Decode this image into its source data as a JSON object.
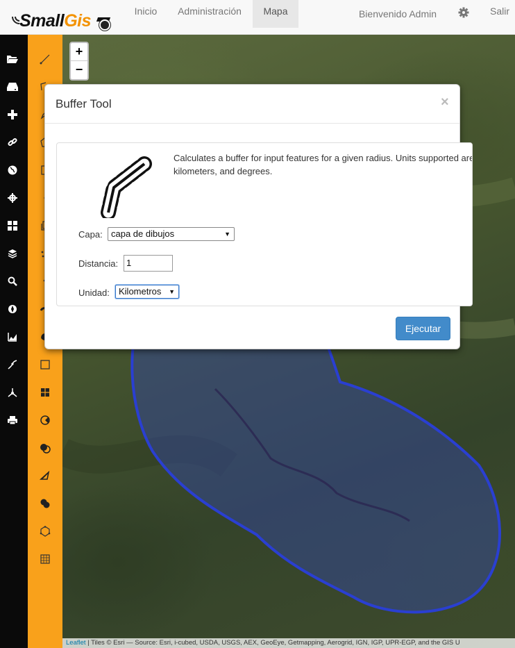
{
  "brand": {
    "name_part1": "Small",
    "name_part2": "Gis"
  },
  "nav": {
    "inicio": "Inicio",
    "administracion": "Administración",
    "mapa": "Mapa",
    "welcome": "Bienvenido Admin",
    "salir": "Salir",
    "settings_icon": "gear-icon"
  },
  "dark_sidebar": [
    "folder-open-icon",
    "hdd-icon",
    "plus-icon",
    "link-icon",
    "globe-icon",
    "crosshair-icon",
    "th-large-icon",
    "layers-icon",
    "search-icon",
    "compass-icon",
    "area-chart-icon",
    "line-tool-icon",
    "vertex-icon",
    "print-icon"
  ],
  "orange_toolbar": [
    "draw-line-icon",
    "draw-polygon-icon",
    "edit-icon",
    "polygon-icon",
    "clipboard-icon",
    "point-icon",
    "copy-icon",
    "dots-icon",
    "point-small-icon",
    "shape-icon",
    "blob-icon",
    "square-outline-icon",
    "square-split-icon",
    "circle-cut-icon",
    "circle-overlap-icon",
    "triangle-icon",
    "circles-icon",
    "hexagon-icon",
    "grid-icon"
  ],
  "map": {
    "zoom_in": "+",
    "zoom_out": "−",
    "buffer_color": "#2a3fd1",
    "attribution_leaflet": "Leaflet",
    "attribution_rest": " | Tiles © Esri — Source: Esri, i-cubed, USDA, USGS, AEX, GeoEye, Getmapping, Aerogrid, IGN, IGP, UPR-EGP, and the GIS U"
  },
  "modal": {
    "title": "Buffer Tool",
    "close": "×",
    "description": "Calculates a buffer for input features for a given radius. Units supported are miles, kilometers, and degrees.",
    "capa_label": "Capa:",
    "capa_value": "capa de dibujos",
    "distancia_label": "Distancia:",
    "distancia_value": "1",
    "unidad_label": "Unidad:",
    "unidad_value": "Kilometros",
    "execute_button": "Ejecutar"
  },
  "colors": {
    "accent_orange": "#f9a11b",
    "primary_button": "#428bca"
  }
}
